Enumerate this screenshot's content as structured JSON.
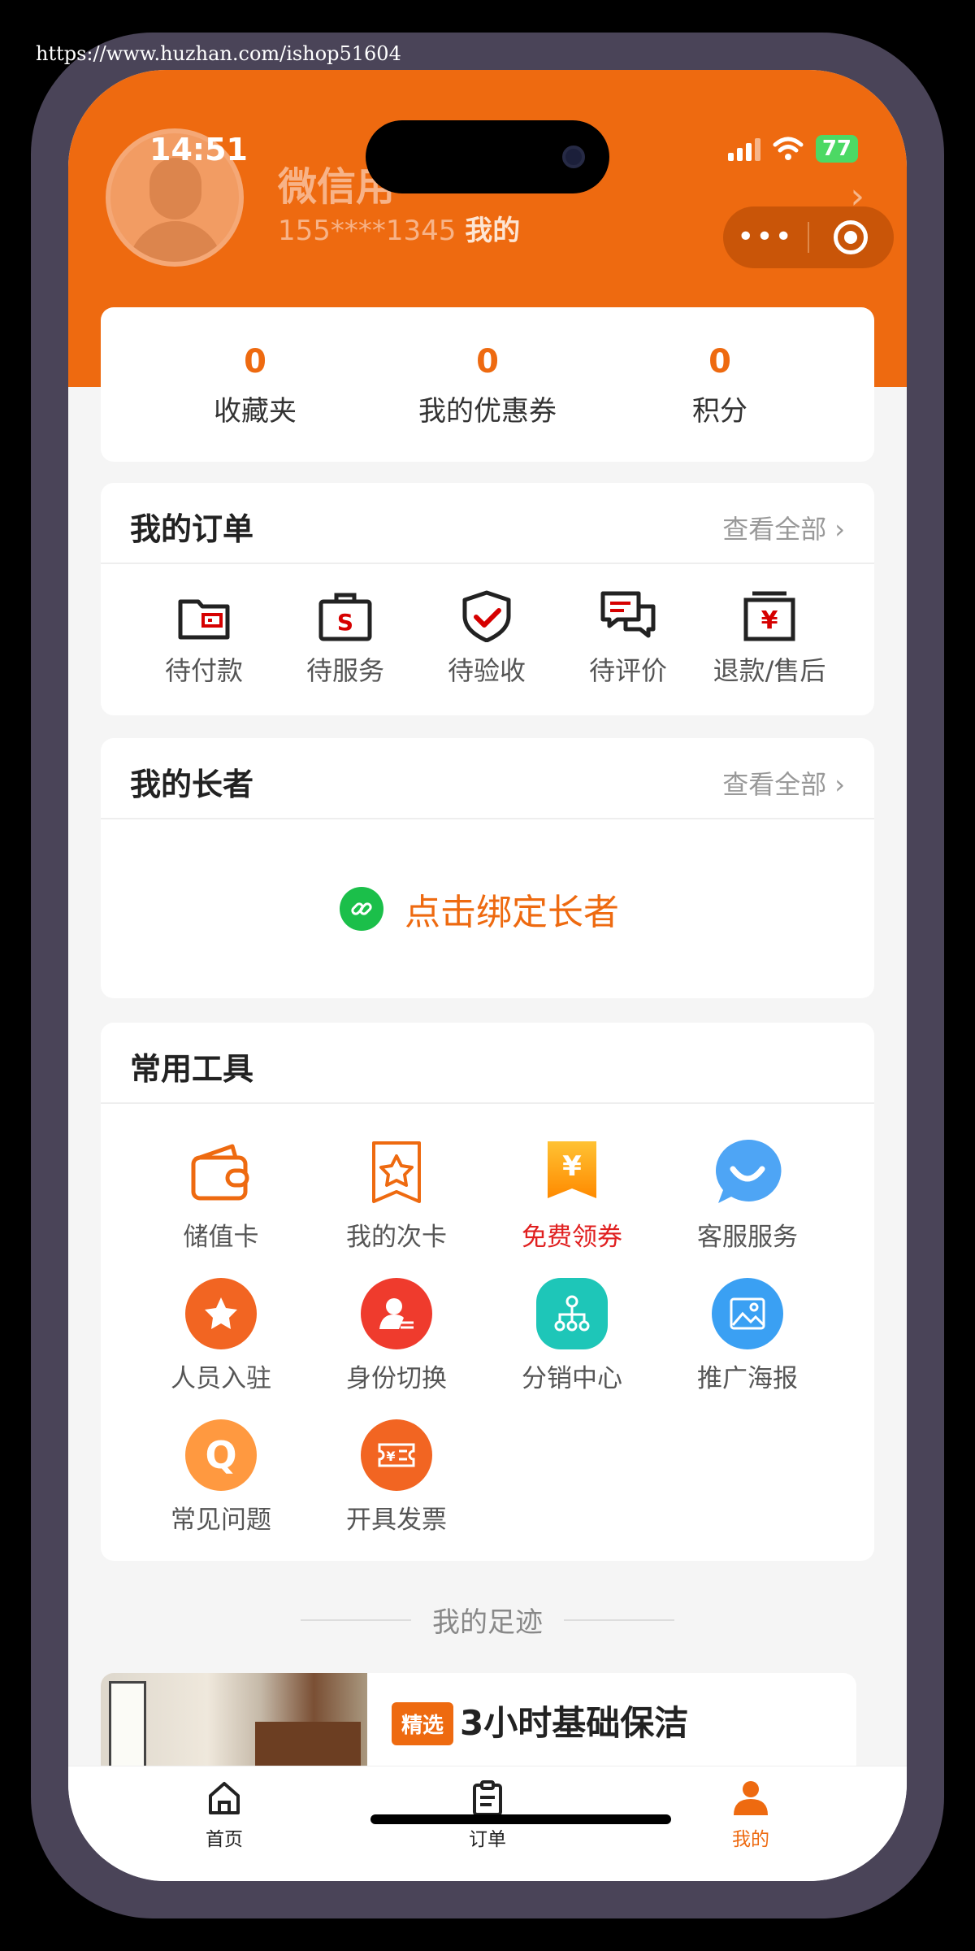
{
  "watermark": "https://www.huzhan.com/ishop51604",
  "status": {
    "time": "14:51",
    "battery": "77"
  },
  "profile": {
    "name": "微信用",
    "phone": "155****1345",
    "my_label": "我的"
  },
  "stats": [
    {
      "value": "0",
      "label": "收藏夹"
    },
    {
      "value": "0",
      "label": "我的优惠券"
    },
    {
      "value": "0",
      "label": "积分"
    }
  ],
  "orders": {
    "title": "我的订单",
    "see_all": "查看全部",
    "items": [
      {
        "label": "待付款",
        "icon": "wallet-icon"
      },
      {
        "label": "待服务",
        "icon": "bag-icon"
      },
      {
        "label": "待验收",
        "icon": "shield-check-icon"
      },
      {
        "label": "待评价",
        "icon": "comment-icon"
      },
      {
        "label": "退款/售后",
        "icon": "refund-icon"
      }
    ]
  },
  "elders": {
    "title": "我的长者",
    "see_all": "查看全部",
    "bind_label": "点击绑定长者"
  },
  "tools": {
    "title": "常用工具",
    "items": [
      {
        "label": "储值卡",
        "icon": "wallet-card-icon"
      },
      {
        "label": "我的次卡",
        "icon": "star-card-icon"
      },
      {
        "label": "免费领券",
        "icon": "coupon-icon",
        "highlight": true
      },
      {
        "label": "客服服务",
        "icon": "chat-bubble-icon"
      },
      {
        "label": "人员入驻",
        "icon": "star-circle-icon"
      },
      {
        "label": "身份切换",
        "icon": "user-switch-icon"
      },
      {
        "label": "分销中心",
        "icon": "network-icon"
      },
      {
        "label": "推广海报",
        "icon": "poster-icon"
      },
      {
        "label": "常见问题",
        "icon": "question-icon"
      },
      {
        "label": "开具发票",
        "icon": "invoice-icon"
      }
    ]
  },
  "footprint": {
    "title": "我的足迹",
    "item": {
      "tag": "精选",
      "title": "3小时基础保洁"
    }
  },
  "tabbar": [
    {
      "label": "首页",
      "icon": "home-icon"
    },
    {
      "label": "订单",
      "icon": "clipboard-icon"
    },
    {
      "label": "我的",
      "icon": "person-icon",
      "active": true
    }
  ],
  "colors": {
    "accent": "#ee6a10",
    "highlight": "#e02020",
    "link_green": "#1bbf4a"
  }
}
